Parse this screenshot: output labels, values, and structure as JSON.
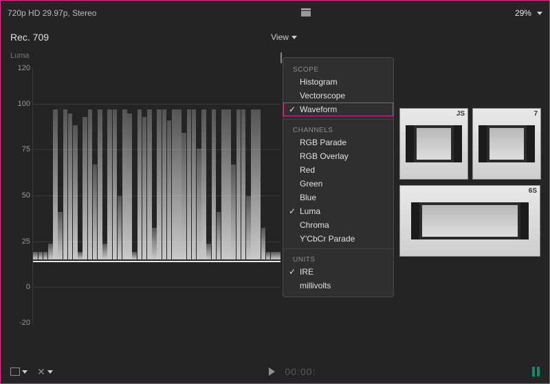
{
  "header": {
    "format": "720p HD 29.97p, Stereo",
    "zoom": "29%"
  },
  "title_row": {
    "project": "Rec. 709",
    "view_label": "View"
  },
  "scope": {
    "ylabel": "Luma",
    "ticks": [
      "120",
      "100",
      "75",
      "50",
      "25",
      "0",
      "-20"
    ]
  },
  "menu": {
    "sections": [
      {
        "header": "SCOPE",
        "items": [
          {
            "label": "Histogram",
            "checked": false,
            "highlight": false
          },
          {
            "label": "Vectorscope",
            "checked": false,
            "highlight": false
          },
          {
            "label": "Waveform",
            "checked": true,
            "highlight": true
          }
        ]
      },
      {
        "header": "CHANNELS",
        "items": [
          {
            "label": "RGB Parade",
            "checked": false
          },
          {
            "label": "RGB Overlay",
            "checked": false
          },
          {
            "label": "Red",
            "checked": false
          },
          {
            "label": "Green",
            "checked": false
          },
          {
            "label": "Blue",
            "checked": false
          },
          {
            "label": "Luma",
            "checked": true
          },
          {
            "label": "Chroma",
            "checked": false
          },
          {
            "label": "Y'CbCr Parade",
            "checked": false
          }
        ]
      },
      {
        "header": "UNITS",
        "items": [
          {
            "label": "IRE",
            "checked": true
          },
          {
            "label": "millivolts",
            "checked": false
          }
        ]
      }
    ]
  },
  "thumbnails": {
    "row1": [
      {
        "label": "JS"
      },
      {
        "label": "7"
      }
    ],
    "row2": [
      {
        "label": "6S"
      }
    ]
  },
  "transport": {
    "timecode": "00:00:"
  }
}
